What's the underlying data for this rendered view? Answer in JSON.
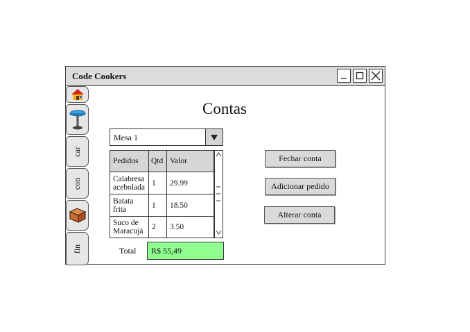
{
  "window": {
    "title": "Code Cookers"
  },
  "sidebar": {
    "tabs": [
      {
        "label": "",
        "icon": "house-icon"
      },
      {
        "label": "",
        "icon": "table-icon"
      },
      {
        "label": "car",
        "icon": ""
      },
      {
        "label": "con",
        "icon": ""
      },
      {
        "label": "",
        "icon": "box-icon"
      },
      {
        "label": "fin",
        "icon": ""
      }
    ]
  },
  "main": {
    "heading": "Contas",
    "table_select": {
      "value": "Mesa 1"
    },
    "orders": {
      "headers": [
        "Pedidos",
        "Qtd",
        "Valor"
      ],
      "rows": [
        {
          "item": "Calabresa acebolada",
          "qty": "1",
          "value": "29.99"
        },
        {
          "item": "Batata frita",
          "qty": "1",
          "value": "18.50"
        },
        {
          "item": "Suco de Maracujá",
          "qty": "2",
          "value": "3.50"
        }
      ]
    },
    "total": {
      "label": "Total",
      "value": "R$ 55,49"
    },
    "buttons": {
      "close_account": "Fechar conta",
      "add_order": "Adicionar pedido",
      "change_account": "Alterar conta"
    }
  },
  "colors": {
    "total_field": "#90ff90",
    "titlebar": "#dcdcdc",
    "button": "#dadada"
  }
}
